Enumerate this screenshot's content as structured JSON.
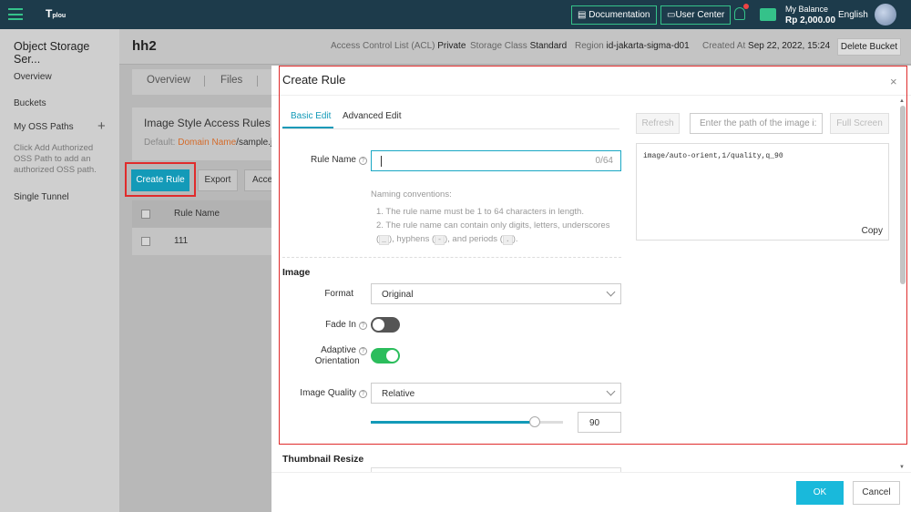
{
  "topbar": {
    "logo_text": "T",
    "logo_small": "plou",
    "documentation": "Documentation",
    "user_center": "User Center",
    "balance_label": "My Balance",
    "balance_value": "Rp 2,000.00",
    "language": "English",
    "accent_color": "#35c28a"
  },
  "sidebar": {
    "title": "Object Storage Ser...",
    "items": [
      {
        "label": "Overview"
      },
      {
        "label": "Buckets"
      },
      {
        "label": "My OSS Paths"
      },
      {
        "label": "Single Tunnel"
      }
    ],
    "note": "Click Add Authorized OSS Path to add an authorized OSS path."
  },
  "header": {
    "bucket_name": "hh2",
    "acl_label": "Access Control List (ACL)",
    "acl_value": "Private",
    "storage_label": "Storage Class",
    "storage_value": "Standard",
    "region_label": "Region",
    "region_value": "id-jakarta-sigma-d01",
    "created_label": "Created At",
    "created_value": "Sep 22, 2022, 15:24",
    "delete_bucket": "Delete Bucket"
  },
  "page_tabs": [
    "Overview",
    "Files"
  ],
  "rules_card": {
    "title": "Image Style Access Rules",
    "default_label": "Default:",
    "domain_name": "Domain Name",
    "path": "/sample.jp"
  },
  "toolbar": {
    "create_rule": "Create Rule",
    "export": "Export",
    "access": "Acce"
  },
  "table": {
    "header": "Rule Name",
    "rows": [
      {
        "name": "111"
      }
    ]
  },
  "modal": {
    "title": "Create Rule",
    "close": "×",
    "tabs": {
      "basic": "Basic Edit",
      "advanced": "Advanced Edit"
    },
    "rule_name_label": "Rule Name",
    "rule_name_value": "",
    "rule_name_count": "0/64",
    "naming_title": "Naming conventions:",
    "naming_1": "1. The rule name must be 1 to 64 characters in length.",
    "naming_2": "2. The rule name can contain only digits, letters, underscores",
    "naming_underscore": "_",
    "naming_hyphen": "-",
    "naming_period": ".",
    "naming_hyphens_text": "), hyphens (",
    "naming_periods_text": "), and periods (",
    "naming_end": ").",
    "image_section": "Image",
    "format_label": "Format",
    "format_value": "Original",
    "fade_in_label": "Fade In",
    "fade_in_on": false,
    "adaptive_label_1": "Adaptive",
    "adaptive_label_2": "Orientation",
    "adaptive_on": true,
    "quality_label": "Image Quality",
    "quality_mode": "Relative",
    "quality_value": "90",
    "quality_level": 0.9,
    "thumbnail_section": "Thumbnail Resize",
    "refresh": "Refresh",
    "path_placeholder": "Enter the path of the image i:",
    "full_screen": "Full Screen",
    "preview_code": "image/auto-orient,1/quality,q_90",
    "copy": "Copy",
    "ok": "OK",
    "cancel": "Cancel",
    "primary_color": "#139ab8",
    "toggle_on_color": "#2bbd5c"
  }
}
